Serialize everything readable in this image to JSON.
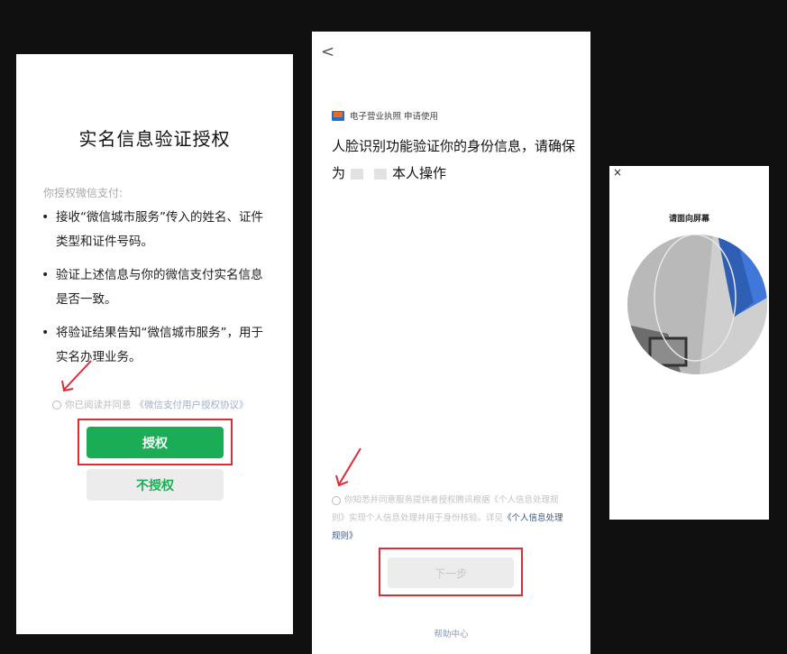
{
  "screen1": {
    "title": "实名信息验证授权",
    "subtitle": "你授权微信支付:",
    "bullets": [
      "接收“微信城市服务”传入的姓名、证件类型和证件号码。",
      "验证上述信息与你的微信支付实名信息是否一致。",
      "将验证结果告知“微信城市服务”，用于实名办理业务。"
    ],
    "agreement_prefix": "你已阅读并同意",
    "agreement_link": "《微信支付用户授权协议》",
    "authorize_button": "授权",
    "deny_button": "不授权"
  },
  "screen2": {
    "back": "<",
    "brand_name": "电子营业执照 申请使用",
    "face_title_part1": "人脸识别功能验证你的身份信息，请确保为",
    "face_title_part2": "本人操作",
    "terms_text": "你知悉并同意服务提供者授权腾讯根据《个人信息处理规则》实现个人信息处理并用于身份核验。详见",
    "terms_link": "《个人信息处理规则》",
    "next_button": "下一步",
    "help_link": "帮助中心"
  },
  "screen3": {
    "close": "×",
    "hint": "请面向屏幕"
  },
  "colors": {
    "accent_green": "#1aad55",
    "highlight_red": "#e02a36"
  }
}
